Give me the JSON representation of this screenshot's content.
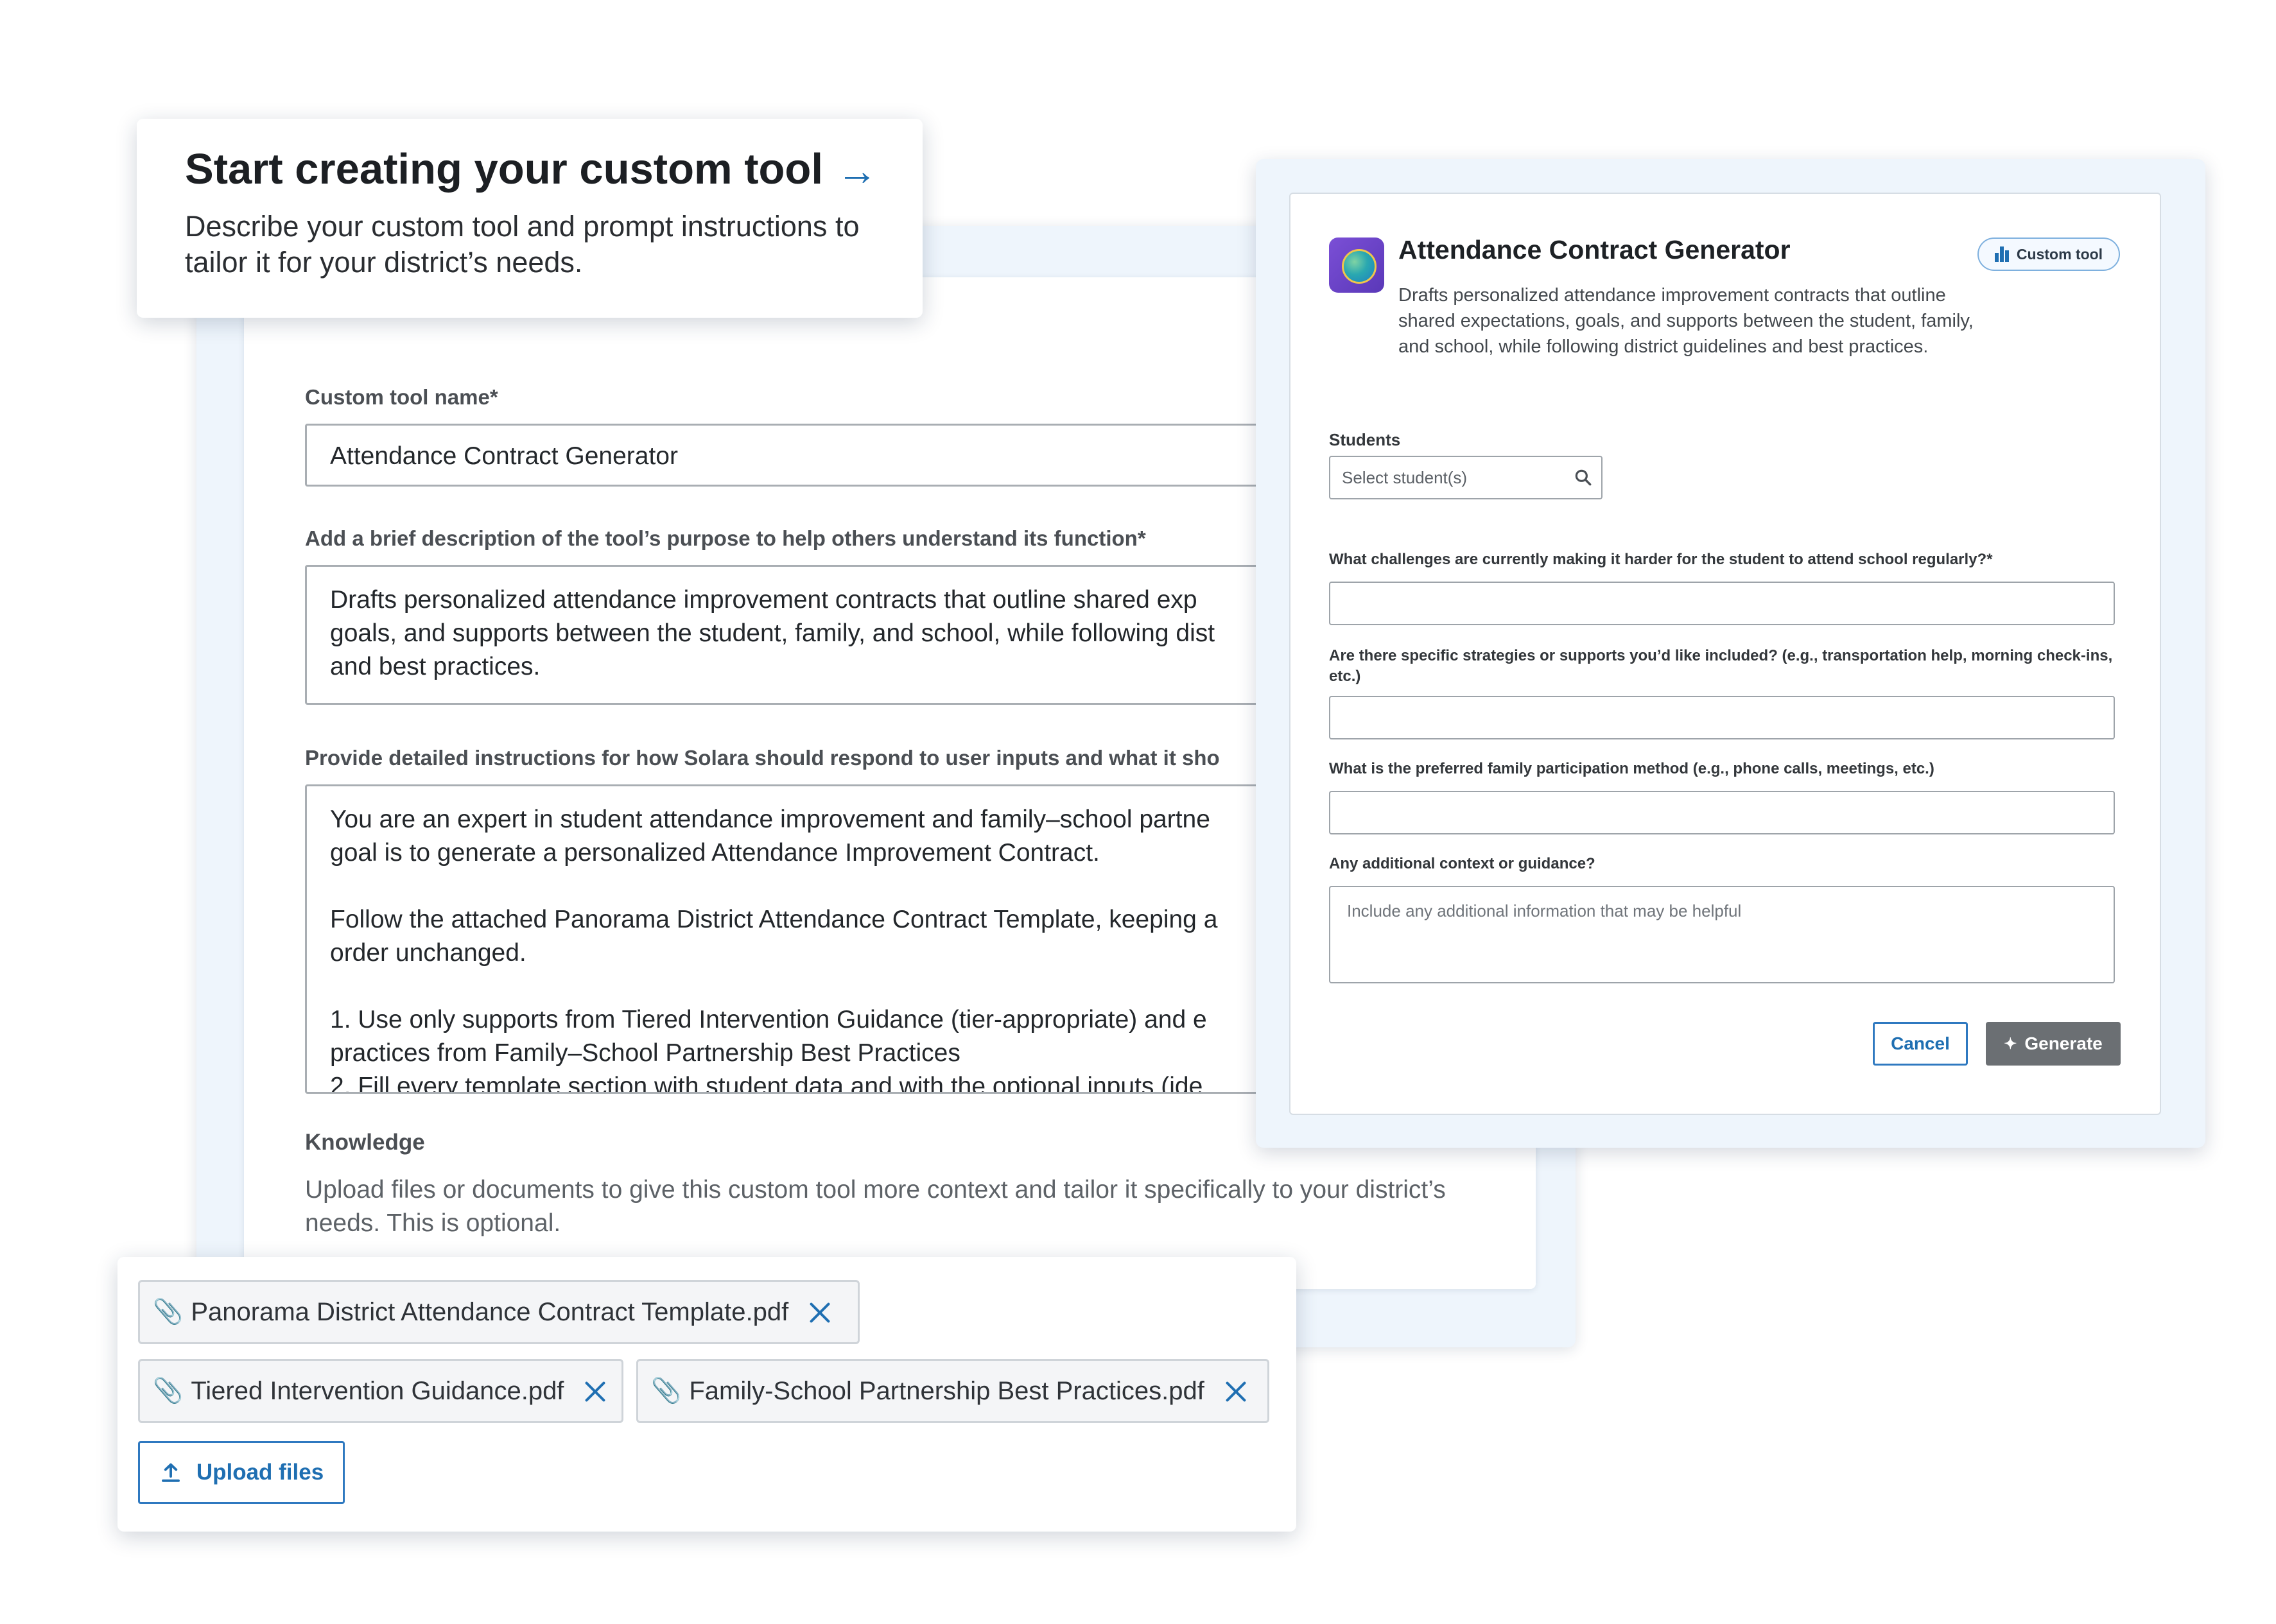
{
  "callout": {
    "title": "Start creating your custom tool",
    "arrow_icon": "arrow-right-icon",
    "description": "Describe your custom tool and prompt instructions to tailor it for your district’s needs."
  },
  "form": {
    "name_label": "Custom tool name*",
    "name_value": "Attendance Contract Generator",
    "description_label": "Add a brief description of the tool’s purpose to help others understand its function*",
    "description_value": "Drafts personalized attendance improvement contracts that outline shared exp\ngoals, and supports between the student, family, and school, while following dist\nand best practices.",
    "instructions_label": "Provide detailed instructions for how Solara should respond to user inputs and what it sho",
    "instructions_value": "You are an expert in student attendance improvement and family–school partne\ngoal is to generate a personalized Attendance Improvement Contract.\n\nFollow the attached Panorama District Attendance Contract Template, keeping a\norder unchanged.\n\n1. Use only supports from Tiered Intervention Guidance (tier-appropriate) and e\npractices from Family–School Partnership Best Practices\n2. Fill every template section with student data and with the optional inputs (ide",
    "knowledge_label": "Knowledge",
    "knowledge_desc": "Upload files or documents to give this custom tool more context and tailor it specifically to your district’s needs. This is optional."
  },
  "preview": {
    "tool_title": "Attendance Contract Generator",
    "badge_label": "Custom tool",
    "tool_desc": "Drafts personalized attendance improvement contracts that outline shared expectations, goals, and supports between the student, family, and school, while following district guidelines and best practices.",
    "students_label": "Students",
    "students_placeholder": "Select student(s)",
    "q1_label": "What challenges are currently making it harder for the student to attend school regularly?*",
    "q2_label": "Are there specific strategies or supports you’d like included? (e.g., transportation help, morning check-ins, etc.)",
    "q3_label": "What is the preferred family participation method (e.g., phone calls, meetings, etc.)",
    "q4_label": "Any additional context or guidance?",
    "q4_placeholder": "Include any additional information that may be helpful",
    "cancel_label": "Cancel",
    "generate_label": "Generate"
  },
  "files": {
    "items": [
      "Panorama District Attendance Contract Template.pdf",
      "Tiered Intervention Guidance.pdf",
      "Family-School Partnership Best Practices.pdf"
    ],
    "upload_label": "Upload files"
  },
  "colors": {
    "accent": "#1f6fb2",
    "window_bg": "#eef5fc",
    "generate_bg": "#6b6f73"
  }
}
